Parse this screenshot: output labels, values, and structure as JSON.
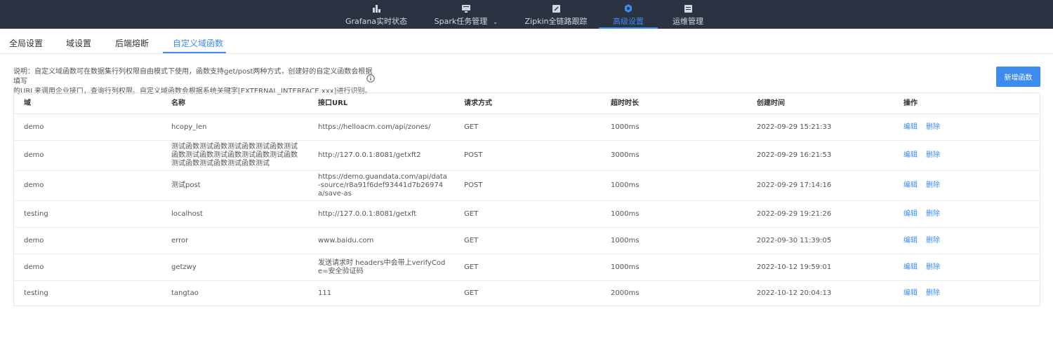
{
  "nav": {
    "items": [
      {
        "label": "Grafana实时状态",
        "icon": "bar-chart-icon"
      },
      {
        "label": "Spark任务管理",
        "icon": "monitor-icon",
        "chevron": "⌄"
      },
      {
        "label": "Zipkin全链路跟踪",
        "icon": "edit-square-icon"
      },
      {
        "label": "高级设置",
        "icon": "gear-icon"
      },
      {
        "label": "运维管理",
        "icon": "list-icon"
      }
    ],
    "active_index": 3,
    "colors": {
      "bg": "#2b3242",
      "active": "#3b8ced"
    }
  },
  "tabs": [
    {
      "label": "全局设置"
    },
    {
      "label": "域设置"
    },
    {
      "label": "后端熔断"
    },
    {
      "label": "自定义域函数"
    }
  ],
  "active_tab": 3,
  "description": {
    "line1": "说明：自定义域函数可在数据集行列权限自由模式下使用，函数支持get/post两种方式，创建好的自定义函数会根据填写",
    "line2": "的URL来调用企业接口，查询行列权限。自定义域函数会根据系统关键字[EXTERNAL_INTERFACE.xxx]进行识别。"
  },
  "add_button": "新增函数",
  "table": {
    "headers": [
      "域",
      "名称",
      "接口URL",
      "请求方式",
      "超时时长",
      "创建时间",
      "操作"
    ],
    "rows": [
      {
        "domain": "demo",
        "name": "hcopy_len",
        "url": "https://helloacm.com/api/zones/",
        "method": "GET",
        "timeout": "1000ms",
        "created": "2022-09-29 15:21:33"
      },
      {
        "domain": "demo",
        "name": "测试函数测试函数测试函数测试函数测试函数测试函数测试函数测试函数测试函数测试函数测试函数测试函数测试",
        "url": "http://127.0.0.1:8081/getxft2",
        "method": "POST",
        "timeout": "3000ms",
        "created": "2022-09-29 16:21:53"
      },
      {
        "domain": "demo",
        "name": "测试post",
        "url": "https://demo.guandata.com/api/data-source/r8a91f6def93441d7b26974a/save-as",
        "method": "POST",
        "timeout": "1000ms",
        "created": "2022-09-29 17:14:16"
      },
      {
        "domain": "testing",
        "name": "localhost",
        "url": "http://127.0.0.1:8081/getxft",
        "method": "GET",
        "timeout": "1000ms",
        "created": "2022-09-29 19:21:26"
      },
      {
        "domain": "demo",
        "name": "error",
        "url": "www.baidu.com",
        "method": "GET",
        "timeout": "1000ms",
        "created": "2022-09-30 11:39:05"
      },
      {
        "domain": "demo",
        "name": "getzwy",
        "url": "发送请求时 headers中会带上verifyCode=安全验证码",
        "method": "GET",
        "timeout": "1000ms",
        "created": "2022-10-12 19:59:01"
      },
      {
        "domain": "testing",
        "name": "tangtao",
        "url": "111",
        "method": "GET",
        "timeout": "2000ms",
        "created": "2022-10-12 20:04:13"
      }
    ],
    "actions": {
      "edit": "编辑",
      "delete": "删除"
    }
  }
}
